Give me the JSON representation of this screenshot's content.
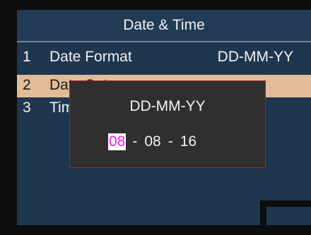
{
  "header": {
    "title": "Date & Time"
  },
  "menu": {
    "items": [
      {
        "number": "1",
        "label": "Date Format",
        "value": "DD-MM-YY"
      },
      {
        "number": "2",
        "label": "Date Set",
        "value": ""
      },
      {
        "number": "3",
        "label": "Time Set",
        "value": ""
      }
    ],
    "selected_index": 1
  },
  "date_popup": {
    "format": "DD-MM-YY",
    "day": "08",
    "month": "08",
    "year": "16",
    "separator": "-",
    "active_field": "day"
  },
  "colors": {
    "background": "#1f364f",
    "highlight": "#e2bc97",
    "popup_bg": "#2f2f2f",
    "popup_border": "#a3252a",
    "active_digit": "#ee22ee"
  }
}
